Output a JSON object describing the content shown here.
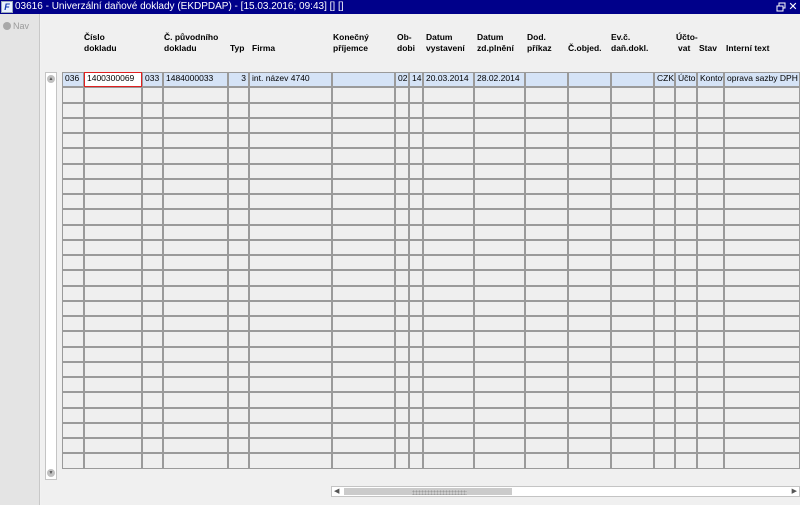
{
  "window": {
    "title": "03616 - Univerzální daňové doklady (EKDPDAP) - [15.03.2016; 09:43] [] []",
    "app_icon_glyph": "F",
    "title_color": "#00008a",
    "close_glyph": "✕"
  },
  "nav": {
    "label": "Nav"
  },
  "columns": [
    {
      "key": "c0",
      "header": ""
    },
    {
      "key": "c1",
      "header": "Číslo dokladu"
    },
    {
      "key": "c2",
      "header": ""
    },
    {
      "key": "c3",
      "header": "Č. původního dokladu"
    },
    {
      "key": "c4",
      "header": "Typ"
    },
    {
      "key": "c5",
      "header": "Firma"
    },
    {
      "key": "c6",
      "header": "Konečný příjemce"
    },
    {
      "key": "c7",
      "header": "Ob-dobi"
    },
    {
      "key": "c8",
      "header": ""
    },
    {
      "key": "c9",
      "header": "Datum vystavení"
    },
    {
      "key": "c10",
      "header": "Datum zd.plnění"
    },
    {
      "key": "c11",
      "header": "Dod. příkaz"
    },
    {
      "key": "c12",
      "header": "Č.objed."
    },
    {
      "key": "c13",
      "header": "Ev.č. daň.dokl."
    },
    {
      "key": "c14",
      "header": ""
    },
    {
      "key": "c15",
      "header": "Účto-vat"
    },
    {
      "key": "c16",
      "header": "Stav"
    },
    {
      "key": "c17",
      "header": "Interní text"
    }
  ],
  "header_lines": {
    "cislo_1": "Číslo",
    "cislo_2": "dokladu",
    "puvodni_1": "Č. původního",
    "puvodni_2": "dokladu",
    "typ": "Typ",
    "firma": "Firma",
    "konecny_1": "Konečný",
    "konecny_2": "příjemce",
    "obdobi_1": "Ob-",
    "obdobi_2": "dobi",
    "dv_1": "Datum",
    "dv_2": "vystavení",
    "dz_1": "Datum",
    "dz_2": "zd.plnění",
    "dod_1": "Dod.",
    "dod_2": "příkaz",
    "cobjed": "Č.objed.",
    "ev_1": "Ev.č.",
    "ev_2": "daň.dokl.",
    "ucto_1": "Účto-",
    "ucto_2": "vat",
    "stav": "Stav",
    "interni": "Interní text"
  },
  "rows": [
    [
      "036",
      "1400300069",
      "033",
      "1484000033",
      "3",
      "int. název 4740",
      "",
      "02",
      "14",
      "20.03.2014",
      "28.02.2014",
      "",
      "",
      "",
      "CZK",
      "Účto",
      "Kontov",
      "oprava sazby DPH"
    ]
  ],
  "empty_row_count": 25,
  "accent": {
    "selected_row": "#d5e3f6",
    "focus_border": "#e02020"
  }
}
